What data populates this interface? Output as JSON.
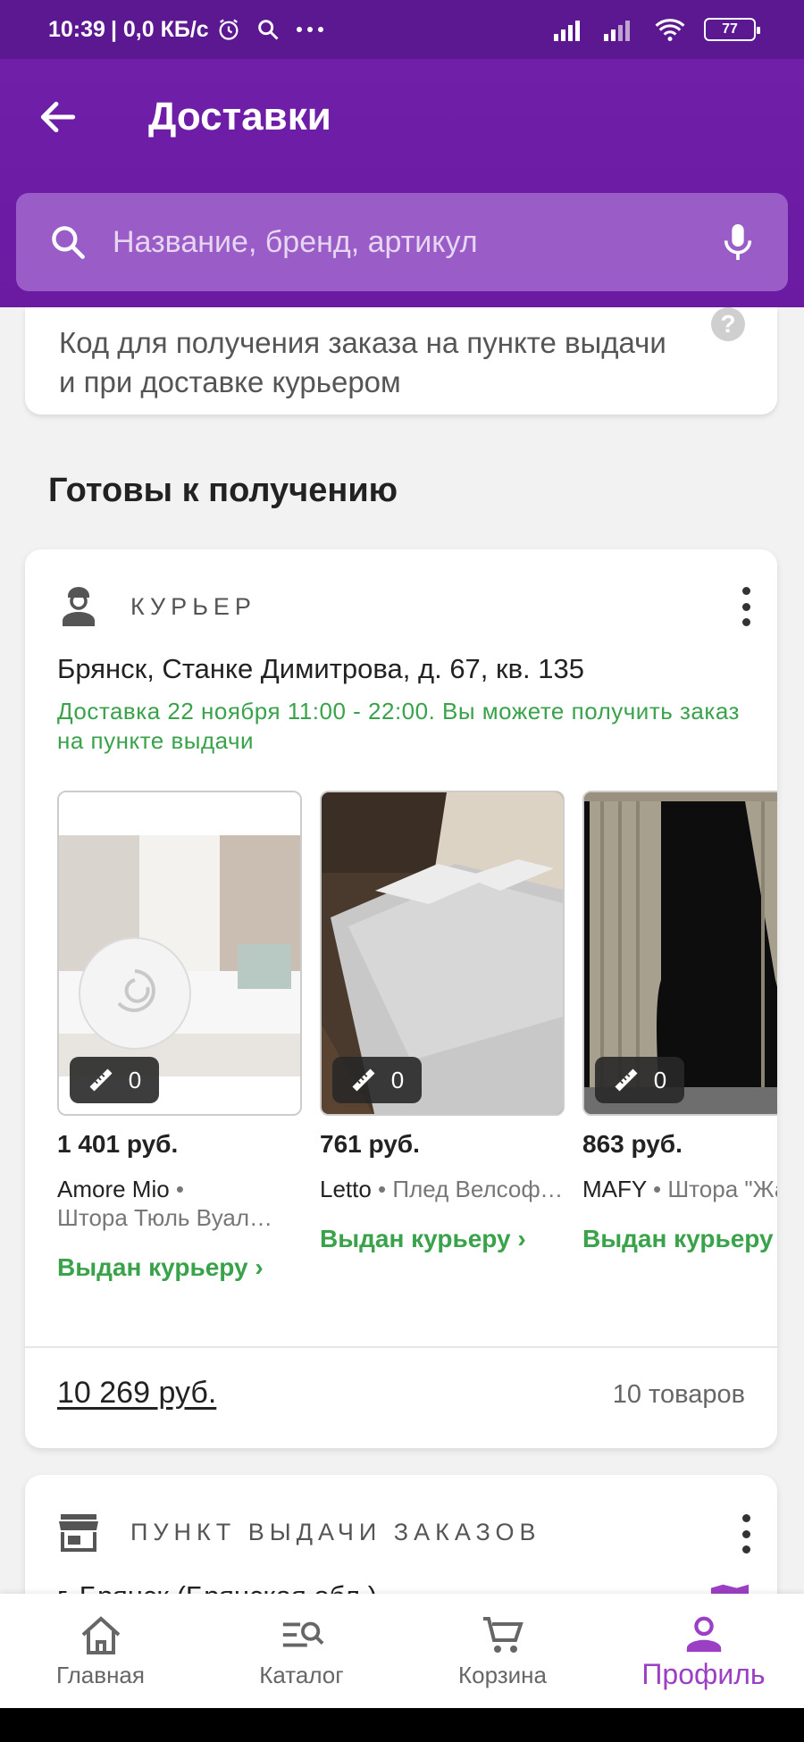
{
  "status_bar": {
    "time": "10:39",
    "speed": "| 0,0 КБ/с",
    "battery": "77"
  },
  "header": {
    "title": "Доставки"
  },
  "search": {
    "placeholder": "Название, бренд, артикул"
  },
  "code_card": {
    "text": "Код для получения заказа на пункте выдачи и при доставке курьером",
    "help": "?"
  },
  "section_title": "Готовы к получению",
  "courier_card": {
    "label": "КУРЬЕР",
    "address": "Брянск, Станке Димитрова, д. 67, кв. 135",
    "note": "Доставка 22 ноября 11:00 - 22:00. Вы можете получить заказ на пункте выдачи",
    "products": [
      {
        "price": "1 401 руб.",
        "brand": "Amore Mio",
        "sep": " • ",
        "name": "Штора Тюль Вуал…",
        "status": "Выдан курьеру ›",
        "reviews": "0"
      },
      {
        "price": "761 руб.",
        "brand": "Letto",
        "sep": " • ",
        "name": "Плед Велсофт, размер …",
        "status": "Выдан курьеру ›",
        "reviews": "0"
      },
      {
        "price": "863 руб.",
        "brand": "MAFY",
        "sep": " • ",
        "name": "Штора \"Жаккард\" CYPR",
        "status": "Выдан курьеру",
        "reviews": "0"
      }
    ],
    "total": "10 269 руб.",
    "count": "10 товаров"
  },
  "pickup_card": {
    "label": "ПУНКТ ВЫДАЧИ ЗАКАЗОВ",
    "address": "г. Брянск (Брянская обл.)"
  },
  "bottom_nav": [
    {
      "label": "Главная",
      "icon": "home-icon"
    },
    {
      "label": "Каталог",
      "icon": "catalog-search-icon"
    },
    {
      "label": "Корзина",
      "icon": "cart-icon"
    },
    {
      "label": "Профиль",
      "icon": "profile-icon",
      "active": true
    }
  ],
  "colors": {
    "header": "#701fa8",
    "accent": "#9b3fc4",
    "green": "#39a24b"
  }
}
